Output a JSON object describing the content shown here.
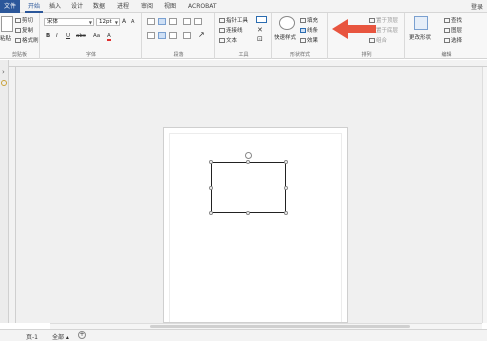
{
  "menubar": {
    "tabs": [
      "文件",
      "开始",
      "插入",
      "设计",
      "数据",
      "进程",
      "审阅",
      "视图",
      "ACROBAT"
    ],
    "login": "登录"
  },
  "clipboard": {
    "paste": "粘贴",
    "cut": "剪切",
    "copy": "复制",
    "format_painter": "格式刷",
    "label": "剪贴板"
  },
  "font": {
    "name": "宋体",
    "size": "12pt",
    "grow": "A",
    "shrink": "A",
    "bold": "B",
    "italic": "I",
    "underline": "U",
    "strike": "abc",
    "case": "Aa",
    "color": "A",
    "label": "字体"
  },
  "paragraph": {
    "label": "段落"
  },
  "tools": {
    "pointer": "指针工具",
    "connector": "连接线",
    "text": "文本",
    "label": "工具"
  },
  "shape_styles": {
    "quick_styles": "快速样式",
    "fill": "填充",
    "line": "线条",
    "effects": "效果",
    "label": "形状样式"
  },
  "arrange": {
    "bring_front": "置于顶层",
    "send_back": "置于底层",
    "group": "组合",
    "label": "排列"
  },
  "editing": {
    "change_shape": "更改形状",
    "find": "查找",
    "layers": "图层",
    "select": "选择",
    "label": "编辑"
  },
  "statusbar": {
    "page": "页-1",
    "all": "全部",
    "add": "+"
  },
  "colors": {
    "accent": "#2b579a",
    "arrow": "#e8553f"
  }
}
